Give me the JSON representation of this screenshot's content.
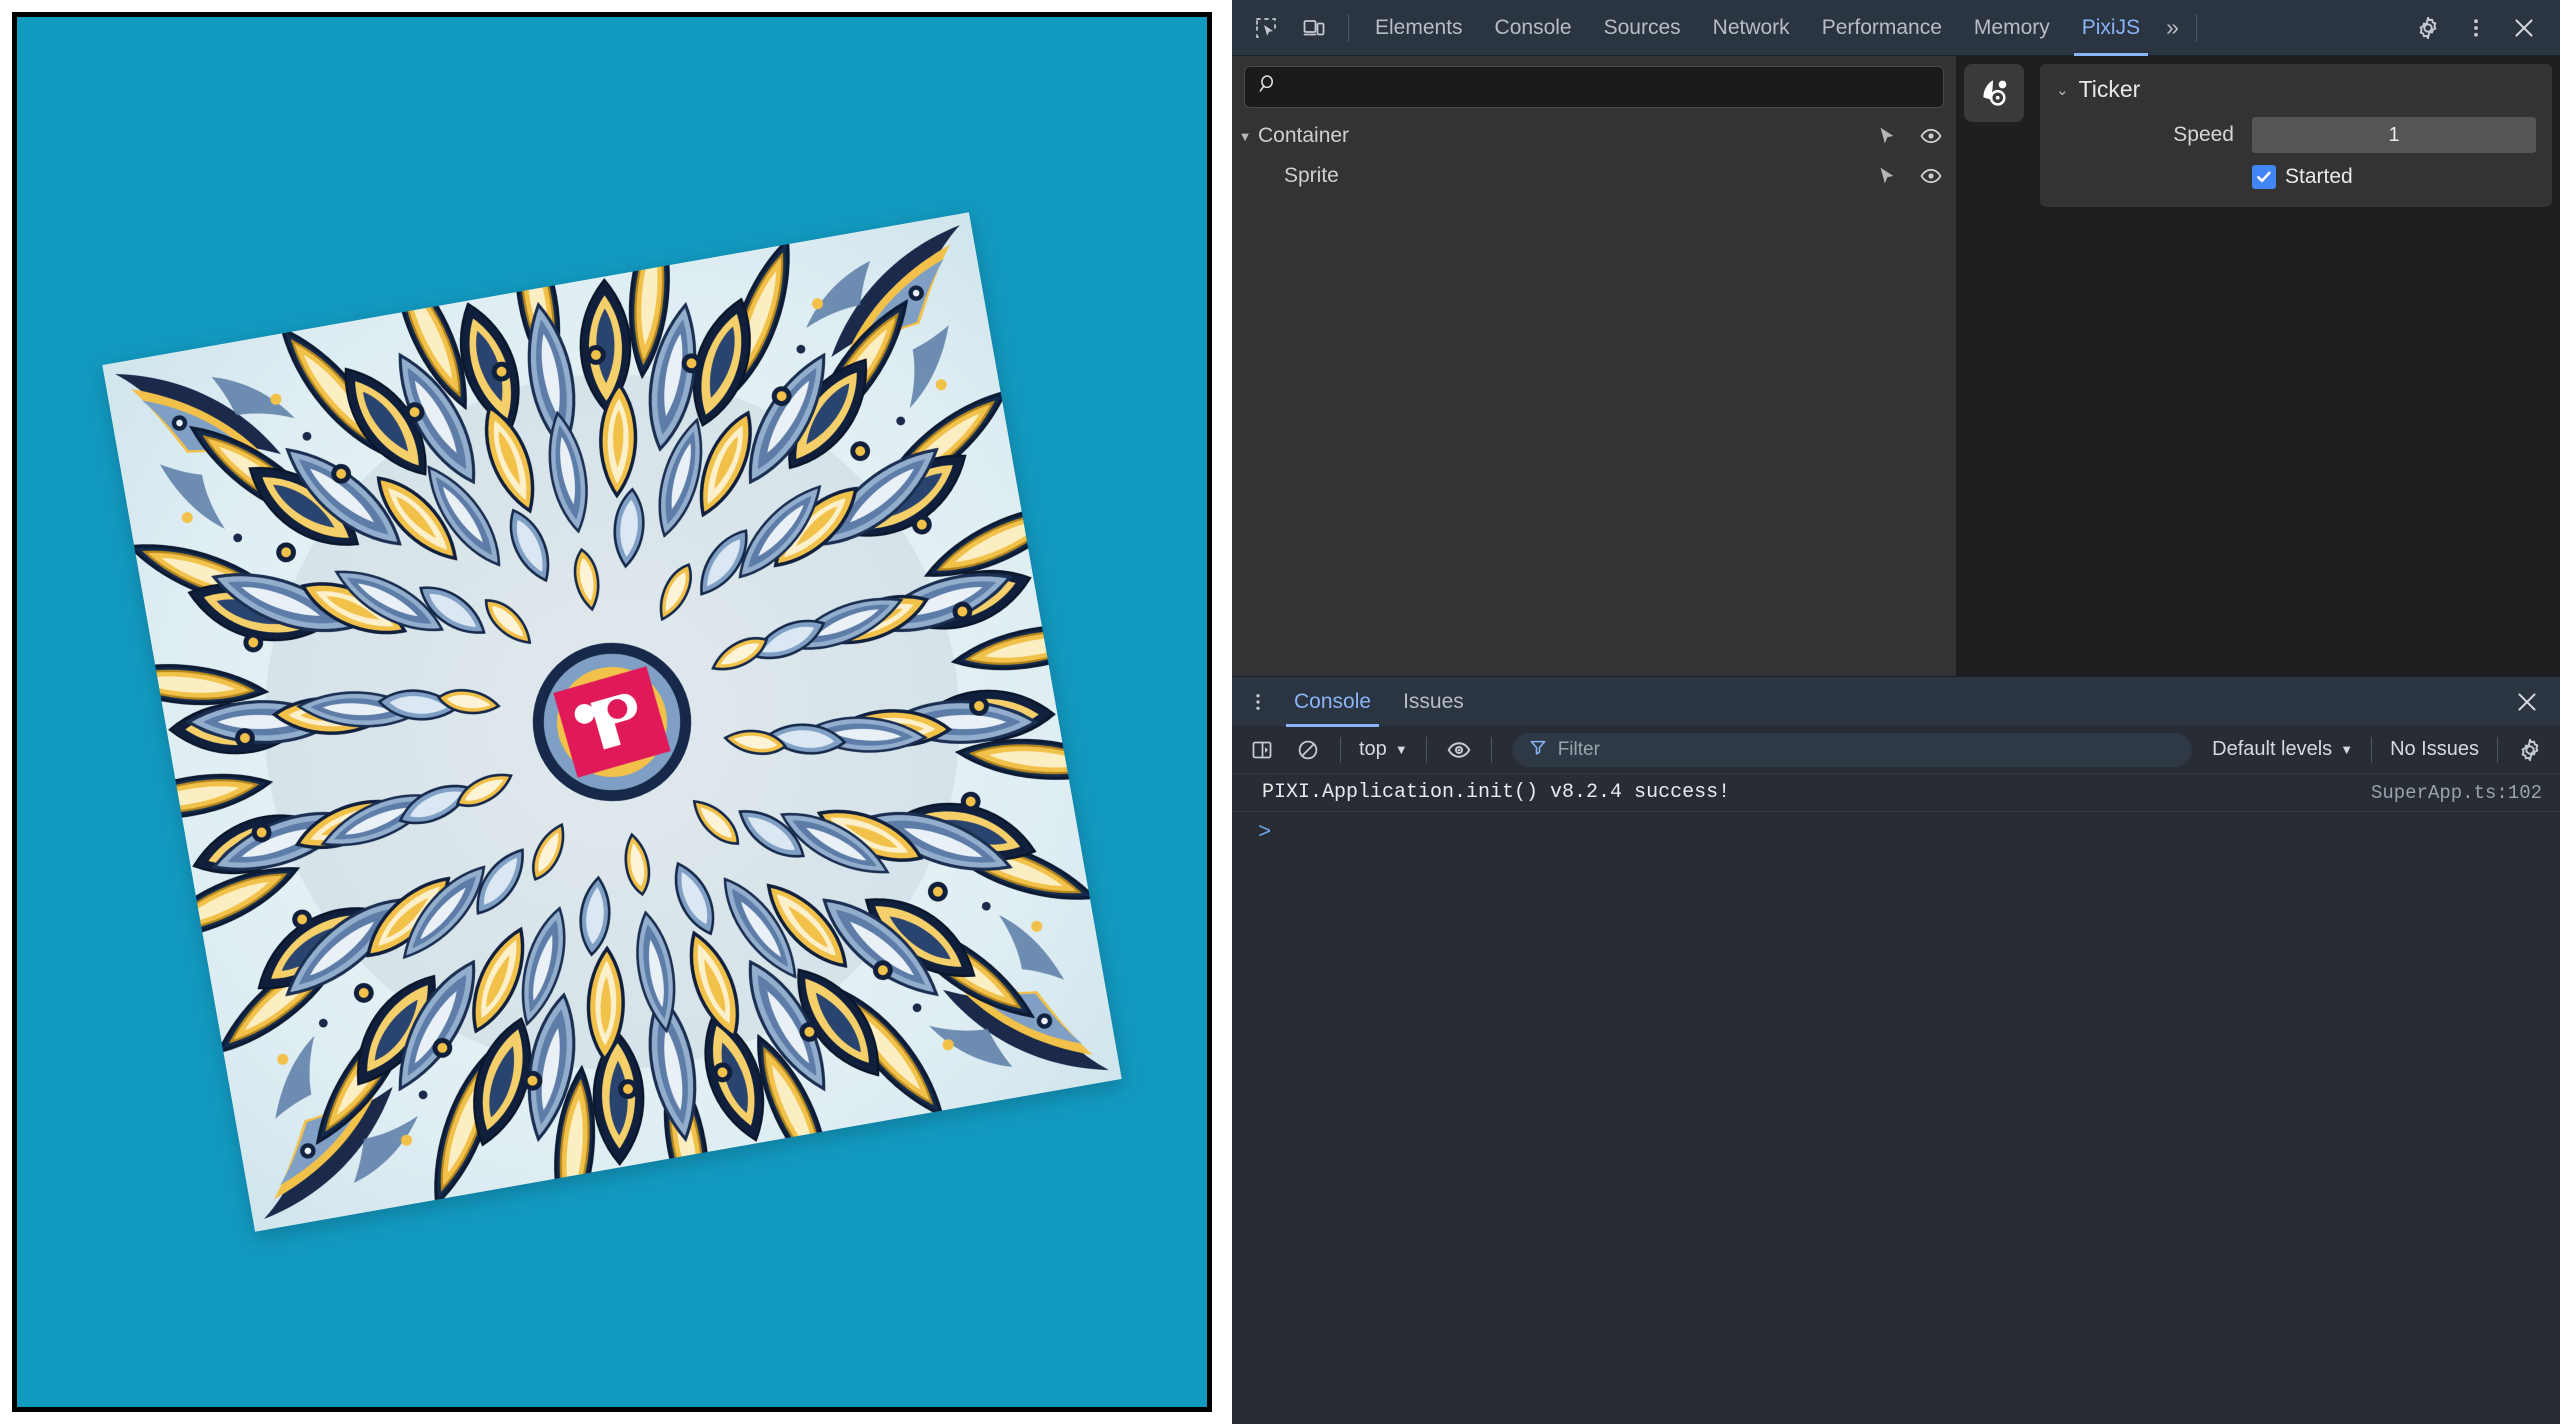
{
  "devtools": {
    "toolbar": {
      "inspect_icon": "inspect-element-icon",
      "device_icon": "device-toolbar-icon",
      "tabs": [
        {
          "label": "Elements",
          "active": false
        },
        {
          "label": "Console",
          "active": false
        },
        {
          "label": "Sources",
          "active": false
        },
        {
          "label": "Network",
          "active": false
        },
        {
          "label": "Performance",
          "active": false
        },
        {
          "label": "Memory",
          "active": false
        },
        {
          "label": "PixiJS",
          "active": true
        }
      ],
      "more_tabs": "»",
      "settings_icon": "gear-icon",
      "menu_icon": "kebab-menu-icon",
      "close_icon": "close-icon",
      "accent_color": "#8ab4f8"
    },
    "scene_tree": {
      "search_placeholder": "",
      "search_value": "",
      "nodes": [
        {
          "label": "Container",
          "depth": 0,
          "expanded": true,
          "has_children": true
        },
        {
          "label": "Sprite",
          "depth": 1,
          "expanded": false,
          "has_children": false
        }
      ]
    },
    "rail": {
      "items": [
        {
          "icon": "pixijs-logo-icon",
          "active": true
        }
      ]
    },
    "inspector": {
      "section_title": "Ticker",
      "section_expanded": true,
      "properties": [
        {
          "label": "Speed",
          "value": "1",
          "type": "number"
        }
      ],
      "checkbox": {
        "label": "Started",
        "checked": true,
        "color": "#4285f4"
      }
    },
    "drawer": {
      "tabs": [
        {
          "label": "Console",
          "active": true
        },
        {
          "label": "Issues",
          "active": false
        }
      ],
      "close_icon": "close-icon",
      "kebab_icon": "more-options-icon",
      "console_toolbar": {
        "sidebar_icon": "console-sidebar-icon",
        "clear_icon": "clear-console-icon",
        "context_label": "top",
        "eye_icon": "live-expression-icon",
        "filter_icon": "filter-icon",
        "filter_placeholder": "Filter",
        "filter_value": "",
        "levels_label": "Default levels",
        "issues_label": "No Issues",
        "settings_icon": "gear-icon"
      },
      "messages": [
        {
          "text": "PIXI.Application.init() v8.2.4 success!",
          "source": "SuperApp.ts:102"
        }
      ],
      "prompt_caret": ">",
      "prompt_value": ""
    }
  },
  "page": {
    "canvas": {
      "background_color": "#1299c0",
      "border_color": "#000000",
      "sprite_name": "mandala-sprite",
      "sprite_rotation_deg": -10,
      "logo_color": "#e01a59"
    }
  }
}
